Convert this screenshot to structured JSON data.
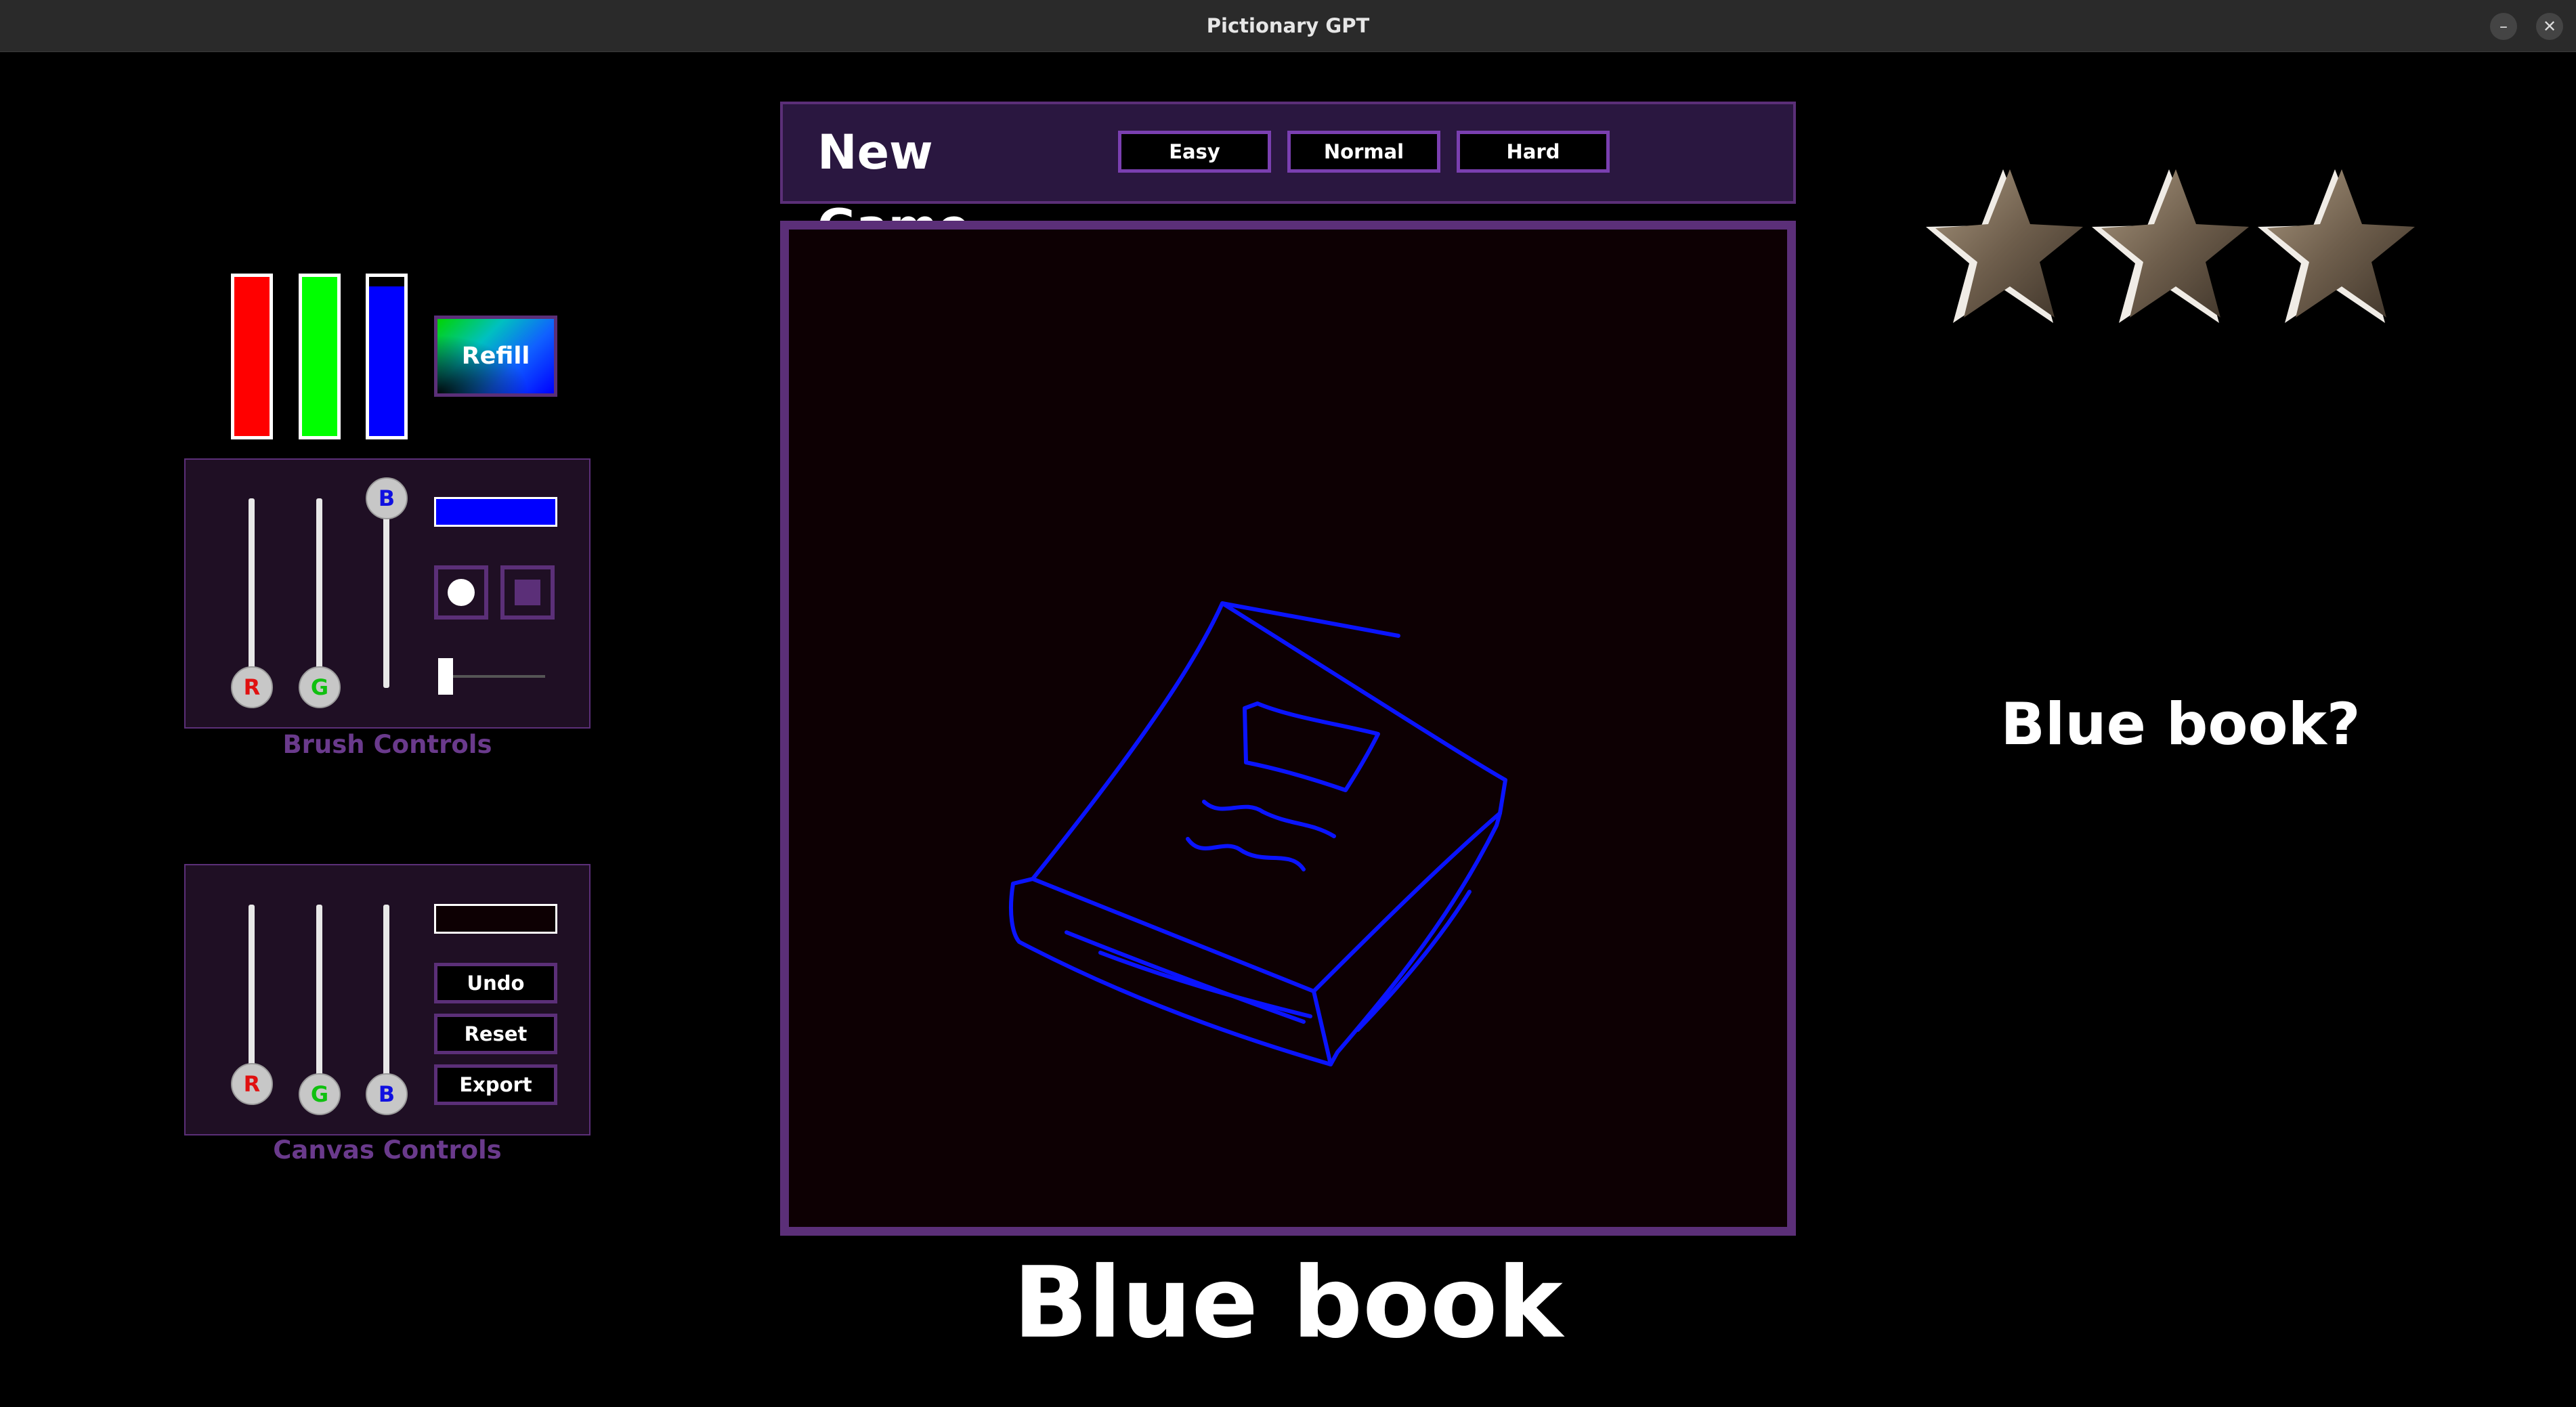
{
  "window": {
    "title": "Pictionary GPT",
    "minimize_glyph": "–",
    "close_glyph": "✕"
  },
  "ink": {
    "refill_label": "Refill",
    "levels": {
      "red": 1.0,
      "green": 1.0,
      "blue": 0.94
    }
  },
  "brush_controls": {
    "title": "Brush Controls",
    "r_label": "R",
    "g_label": "G",
    "b_label": "B",
    "color": "#0000ff",
    "shapes": [
      "circle-brush-icon",
      "square-brush-icon"
    ]
  },
  "canvas_controls": {
    "title": "Canvas Controls",
    "r_label": "R",
    "g_label": "G",
    "b_label": "B",
    "color": "#0d0003",
    "undo_label": "Undo",
    "reset_label": "Reset",
    "export_label": "Export"
  },
  "game": {
    "new_game_label": "New Game",
    "difficulties": [
      "Easy",
      "Normal",
      "Hard"
    ],
    "word": "Blue book",
    "guess": "Blue book?",
    "stars": 3
  },
  "colors": {
    "accent": "#5b2f78",
    "header_bg": "#2a1740",
    "canvas_bg": "#0d0003",
    "stroke": "#0a14ff"
  }
}
